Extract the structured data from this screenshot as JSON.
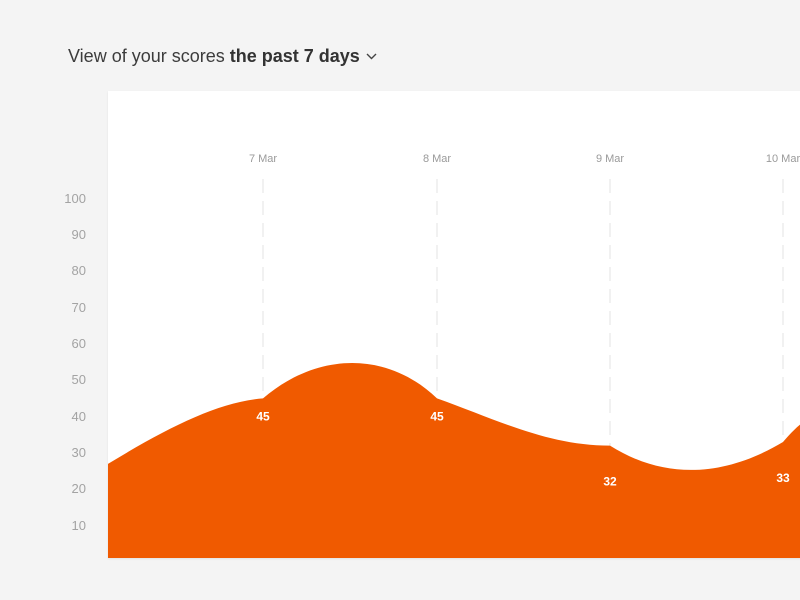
{
  "header": {
    "prefix": "View of your scores",
    "period": "the past 7 days",
    "dropdown_icon": "chevron-down-icon"
  },
  "colors": {
    "area": "#f05a00",
    "gridline": "#e3e3e3",
    "background": "#f4f4f4",
    "card": "#ffffff"
  },
  "chart_data": {
    "type": "area",
    "title": "",
    "xlabel": "",
    "ylabel": "",
    "ylim": [
      0,
      100
    ],
    "yticks": [
      10,
      20,
      30,
      40,
      50,
      60,
      70,
      80,
      90,
      100
    ],
    "categories": [
      "7 Mar",
      "8 Mar",
      "9 Mar",
      "10 Mar"
    ],
    "values": [
      45,
      45,
      32,
      33
    ],
    "grid_vertical": true,
    "grid_style": "dashed",
    "data_labels": true
  }
}
